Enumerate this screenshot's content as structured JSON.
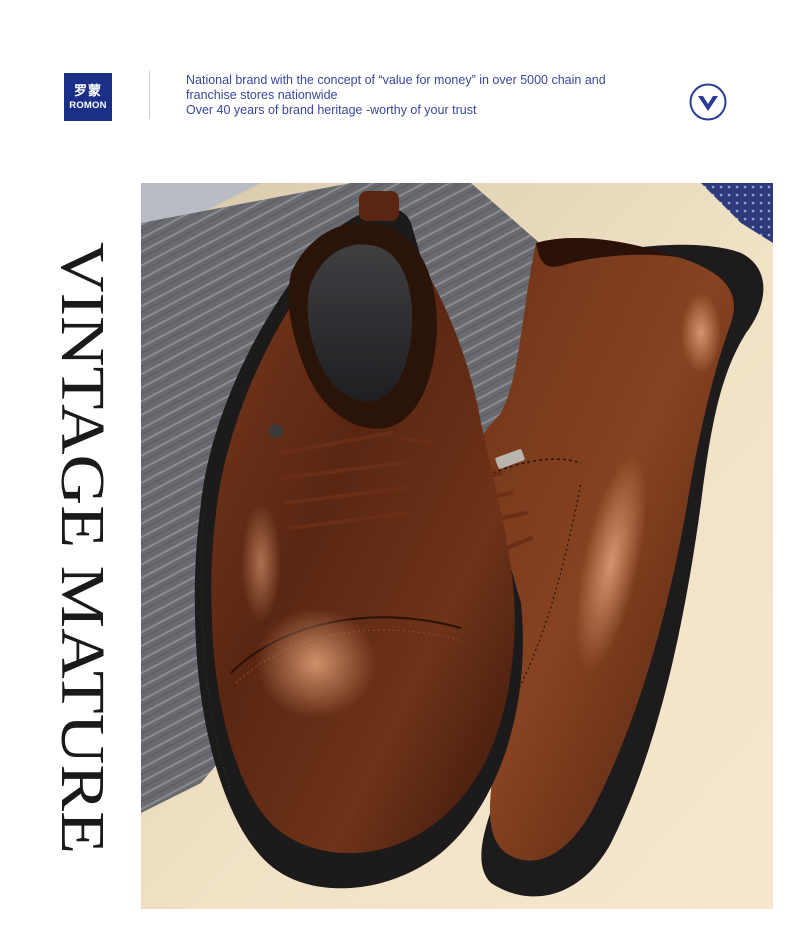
{
  "brand": {
    "logo_cn": "罗蒙",
    "logo_en": "ROMON",
    "color": "#1c2f86"
  },
  "tagline": {
    "line1": "National brand with the concept of  “value for money”  in over 5000 chain and",
    "line2": "franchise stores nationwide",
    "line3": "Over 40 years of brand heritage -worthy of your trust",
    "color": "#3b46a0"
  },
  "icons": {
    "scroll": "chevron-down-circle-icon"
  },
  "headline": {
    "text": "VINTAGE MATURE"
  },
  "photo": {
    "subject": "brown-leather-derby-shoes",
    "colors": {
      "leather": "#5a2612",
      "sole": "#1d1b1b",
      "backdrop": "#efe0c4",
      "fabric": "#6a6c71"
    }
  }
}
